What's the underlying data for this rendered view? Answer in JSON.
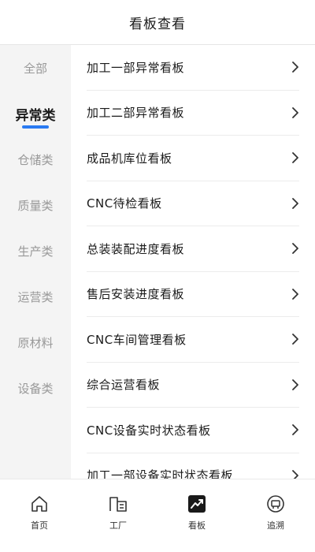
{
  "header": {
    "title": "看板查看"
  },
  "colors": {
    "accent": "#2a7bf2",
    "sidebar_bg": "#f4f4f4",
    "muted": "#999999"
  },
  "sidebar": {
    "items": [
      {
        "label": "全部"
      },
      {
        "label": "异常类",
        "active": true
      },
      {
        "label": "仓储类"
      },
      {
        "label": "质量类"
      },
      {
        "label": "生产类"
      },
      {
        "label": "运营类"
      },
      {
        "label": "原材料"
      },
      {
        "label": "设备类"
      }
    ]
  },
  "list": {
    "items": [
      {
        "label": "加工一部异常看板",
        "icon": "chevron-right-icon"
      },
      {
        "label": "加工二部异常看板",
        "icon": "chevron-right-icon"
      },
      {
        "label": "成品机库位看板",
        "icon": "chevron-right-icon"
      },
      {
        "label": "CNC待检看板",
        "icon": "chevron-right-icon"
      },
      {
        "label": "总装装配进度看板",
        "icon": "chevron-right-icon"
      },
      {
        "label": "售后安装进度看板",
        "icon": "chevron-right-icon"
      },
      {
        "label": "CNC车间管理看板",
        "icon": "chevron-right-icon"
      },
      {
        "label": "综合运营看板",
        "icon": "chevron-right-icon"
      },
      {
        "label": "CNC设备实时状态看板",
        "icon": "chevron-right-icon"
      },
      {
        "label": "加工一部设备实时状态看板",
        "icon": "chevron-right-icon"
      }
    ]
  },
  "tabbar": {
    "items": [
      {
        "label": "首页",
        "icon": "home-icon"
      },
      {
        "label": "工厂",
        "icon": "factory-icon"
      },
      {
        "label": "看板",
        "icon": "dashboard-chart-icon",
        "active": true
      },
      {
        "label": "追溯",
        "icon": "trace-icon"
      }
    ]
  }
}
